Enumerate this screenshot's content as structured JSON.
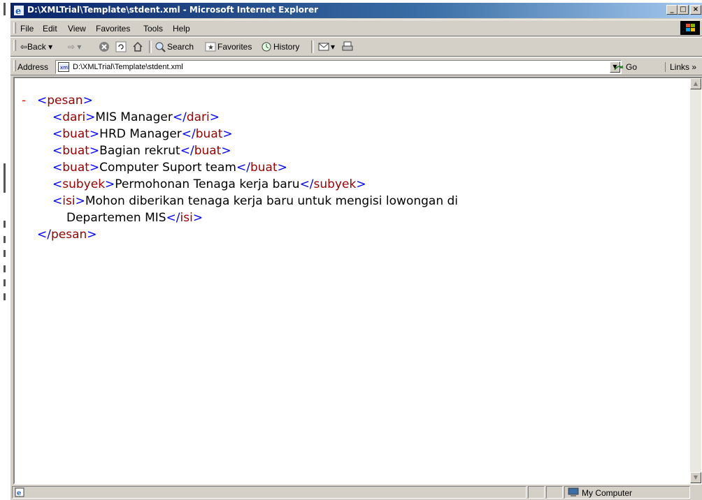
{
  "window": {
    "title": "D:\\XMLTrial\\Template\\stdent.xml - Microsoft Internet Explorer",
    "minimize_glyph": "_",
    "maximize_glyph": "□",
    "close_glyph": "×"
  },
  "menubar": {
    "items": [
      "File",
      "Edit",
      "View",
      "Favorites",
      "Tools",
      "Help"
    ]
  },
  "toolbar": {
    "back_label": "⇦Back ▾",
    "forward_label": "⇨ ▾",
    "stop_icon": "stop-icon",
    "refresh_icon": "refresh-icon",
    "home_icon": "home-icon",
    "search_label": "Search",
    "favorites_label": "Favorites",
    "history_label": "History",
    "mail_label": "▾",
    "print_icon": "print-icon"
  },
  "address": {
    "label": "Address",
    "url": "D:\\XMLTrial\\Template\\stdent.xml",
    "go_label": "Go",
    "links_label": "Links"
  },
  "xml": {
    "minus": "-",
    "root_tag": "pesan",
    "elements": [
      {
        "tag": "dari",
        "text": "MIS Manager"
      },
      {
        "tag": "buat",
        "text": "HRD Manager"
      },
      {
        "tag": "buat",
        "text": "Bagian rekrut"
      },
      {
        "tag": "buat",
        "text": "Computer Suport team"
      },
      {
        "tag": "subyek",
        "text": "Permohonan Tenaga kerja baru"
      }
    ],
    "isi": {
      "tag": "isi",
      "text_line1": "Mohon diberikan tenaga kerja baru untuk mengisi lowongan di",
      "text_line2": "Departemen MIS"
    }
  },
  "statusbar": {
    "zone": "My Computer"
  },
  "colors": {
    "tag_bracket": "#0000ff",
    "tag_name": "#990000",
    "collapse_minus": "#ff0000",
    "titlebar": "#0a246a"
  }
}
